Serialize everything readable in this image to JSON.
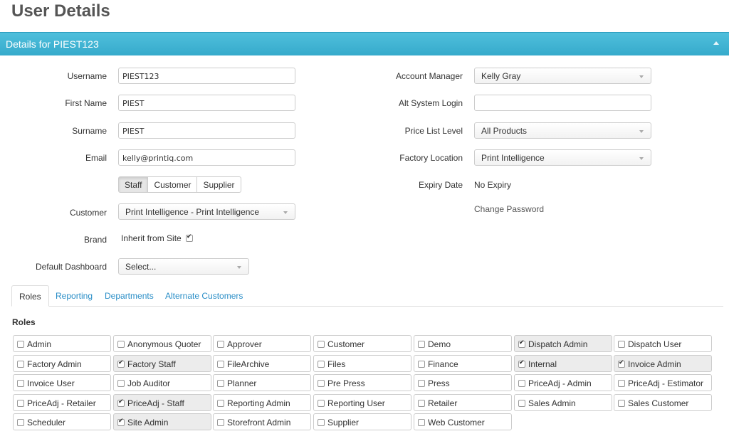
{
  "page": {
    "title": "User Details"
  },
  "panel": {
    "header": "Details for PIEST123"
  },
  "left_form": {
    "username_label": "Username",
    "username_value": "PIEST123",
    "first_name_label": "First Name",
    "first_name_value": "PIEST",
    "surname_label": "Surname",
    "surname_value": "PIEST",
    "email_label": "Email",
    "email_value": "kelly@printiq.com",
    "user_type_buttons": [
      {
        "label": "Staff",
        "active": true
      },
      {
        "label": "Customer",
        "active": false
      },
      {
        "label": "Supplier",
        "active": false
      }
    ],
    "customer_label": "Customer",
    "customer_value": "Print Intelligence - Print Intelligence",
    "brand_label": "Brand",
    "brand_value": "Inherit from Site",
    "brand_checked": true,
    "default_dashboard_label": "Default Dashboard",
    "default_dashboard_value": "Select..."
  },
  "right_form": {
    "account_manager_label": "Account Manager",
    "account_manager_value": "Kelly Gray",
    "alt_login_label": "Alt System Login",
    "alt_login_value": "",
    "price_list_label": "Price List Level",
    "price_list_value": "All Products",
    "factory_location_label": "Factory Location",
    "factory_location_value": "Print Intelligence",
    "expiry_label": "Expiry Date",
    "expiry_value": "No Expiry",
    "change_password": "Change Password"
  },
  "tabs": [
    {
      "label": "Roles",
      "active": true
    },
    {
      "label": "Reporting",
      "active": false
    },
    {
      "label": "Departments",
      "active": false
    },
    {
      "label": "Alternate Customers",
      "active": false
    }
  ],
  "roles_heading": "Roles",
  "roles": [
    {
      "label": "Admin",
      "checked": false
    },
    {
      "label": "Anonymous Quoter",
      "checked": false
    },
    {
      "label": "Approver",
      "checked": false
    },
    {
      "label": "Customer",
      "checked": false
    },
    {
      "label": "Demo",
      "checked": false
    },
    {
      "label": "Dispatch Admin",
      "checked": true
    },
    {
      "label": "Dispatch User",
      "checked": false
    },
    {
      "label": "Factory Admin",
      "checked": false
    },
    {
      "label": "Factory Staff",
      "checked": true
    },
    {
      "label": "FileArchive",
      "checked": false
    },
    {
      "label": "Files",
      "checked": false
    },
    {
      "label": "Finance",
      "checked": false
    },
    {
      "label": "Internal",
      "checked": true
    },
    {
      "label": "Invoice Admin",
      "checked": true
    },
    {
      "label": "Invoice User",
      "checked": false
    },
    {
      "label": "Job Auditor",
      "checked": false
    },
    {
      "label": "Planner",
      "checked": false
    },
    {
      "label": "Pre Press",
      "checked": false
    },
    {
      "label": "Press",
      "checked": false
    },
    {
      "label": "PriceAdj - Admin",
      "checked": false
    },
    {
      "label": "PriceAdj - Estimator",
      "checked": false
    },
    {
      "label": "PriceAdj - Retailer",
      "checked": false
    },
    {
      "label": "PriceAdj - Staff",
      "checked": true
    },
    {
      "label": "Reporting Admin",
      "checked": false
    },
    {
      "label": "Reporting User",
      "checked": false
    },
    {
      "label": "Retailer",
      "checked": false
    },
    {
      "label": "Sales Admin",
      "checked": false
    },
    {
      "label": "Sales Customer",
      "checked": false
    },
    {
      "label": "Scheduler",
      "checked": false
    },
    {
      "label": "Site Admin",
      "checked": true
    },
    {
      "label": "Storefront Admin",
      "checked": false
    },
    {
      "label": "Supplier",
      "checked": false
    },
    {
      "label": "Web Customer",
      "checked": false
    }
  ]
}
